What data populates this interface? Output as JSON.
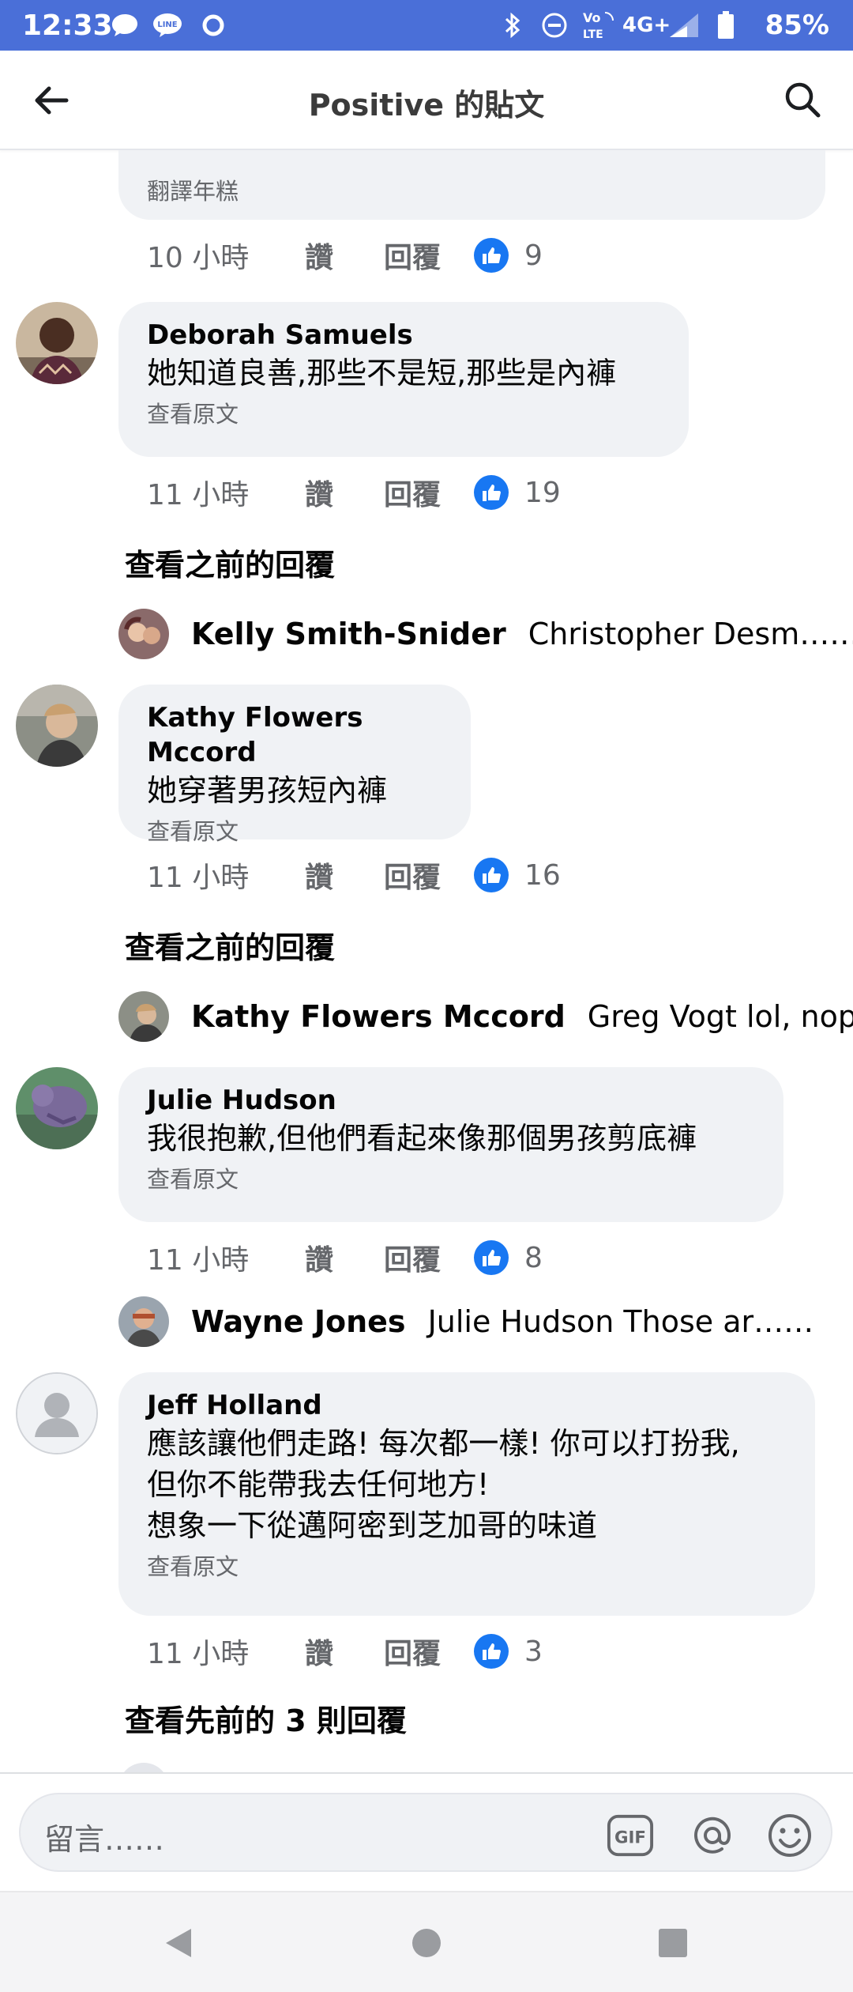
{
  "status_bar": {
    "time": "12:33",
    "battery": "85%",
    "network": "4G+",
    "volte": "VoLTE"
  },
  "header": {
    "title": "Positive 的貼文"
  },
  "top_comment": {
    "translation_label": "翻譯年糕",
    "time": "10 小時",
    "like": "讚",
    "reply": "回覆",
    "reactions": "9"
  },
  "comments": [
    {
      "author": "Deborah Samuels",
      "text": "她知道良善,那些不是短,那些是內褲",
      "see_original": "查看原文",
      "time": "11 小時",
      "like": "讚",
      "reply": "回覆",
      "reactions": "19",
      "previous_replies": "查看之前的回覆",
      "reply_preview": {
        "author": "Kelly Smith-Snider",
        "text": "Christopher Desm……"
      }
    },
    {
      "author": "Kathy Flowers Mccord",
      "text": "她穿著男孩短內褲",
      "see_original": "查看原文",
      "time": "11 小時",
      "like": "讚",
      "reply": "回覆",
      "reactions": "16",
      "previous_replies": "查看之前的回覆",
      "reply_preview": {
        "author": "Kathy Flowers Mccord",
        "text": "Greg Vogt lol, nope"
      }
    },
    {
      "author": "Julie Hudson",
      "text": "我很抱歉,但他們看起來像那個男孩剪底褲",
      "see_original": "查看原文",
      "time": "11 小時",
      "like": "讚",
      "reply": "回覆",
      "reactions": "8",
      "reply_preview": {
        "author": "Wayne Jones",
        "text": "Julie Hudson Those ar……"
      }
    },
    {
      "author": "Jeff Holland",
      "text_lines": [
        "應該讓他們走路! 每次都一樣! 你可以打扮我,",
        "但你不能帶我去任何地方!",
        "想象一下從邁阿密到芝加哥的味道"
      ],
      "see_original": "查看原文",
      "time": "11 小時",
      "like": "讚",
      "reply": "回覆",
      "reactions": "3",
      "previous_replies": "查看先前的 3 則回覆"
    }
  ],
  "comment_bar": {
    "placeholder": "留言……",
    "gif_label": "GIF"
  },
  "icons": {
    "back": "back-arrow-icon",
    "search": "search-icon",
    "like_reaction": "thumbs-up-icon",
    "gif": "gif-icon",
    "mention": "at-icon",
    "emoji": "smiley-icon",
    "nav_back": "nav-back-icon",
    "nav_home": "nav-home-icon",
    "nav_recents": "nav-recents-icon"
  },
  "colors": {
    "status_bar": "#4a6fd8",
    "bubble": "#f0f2f5",
    "reaction": "#1877f2",
    "meta_text": "#65676b"
  }
}
